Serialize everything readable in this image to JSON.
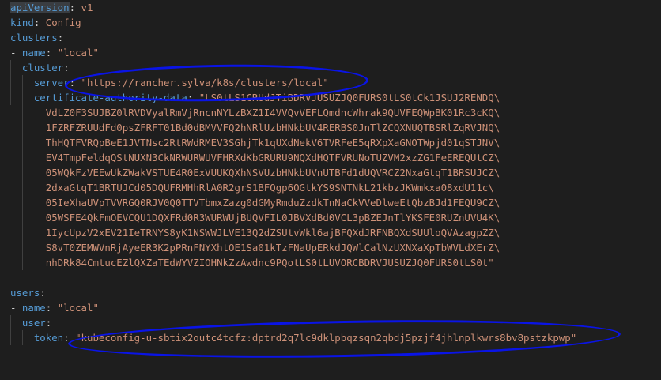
{
  "editor": {
    "lines": [
      {
        "indent": "",
        "tokens": [
          {
            "t": "apiVersion",
            "c": "key"
          },
          {
            "t": ": ",
            "c": "plain"
          },
          {
            "t": "v1",
            "c": "str"
          }
        ]
      },
      {
        "indent": "",
        "tokens": [
          {
            "t": "kind",
            "c": "key"
          },
          {
            "t": ": ",
            "c": "plain"
          },
          {
            "t": "Config",
            "c": "str"
          }
        ]
      },
      {
        "indent": "",
        "tokens": [
          {
            "t": "clusters",
            "c": "key"
          },
          {
            "t": ":",
            "c": "plain"
          }
        ]
      },
      {
        "indent": "",
        "tokens": [
          {
            "t": "- ",
            "c": "plain"
          },
          {
            "t": "name",
            "c": "key"
          },
          {
            "t": ": ",
            "c": "plain"
          },
          {
            "t": "\"local\"",
            "c": "str"
          }
        ]
      },
      {
        "indent": "  ",
        "tokens": [
          {
            "t": "cluster",
            "c": "key"
          },
          {
            "t": ":",
            "c": "plain"
          }
        ]
      },
      {
        "indent": "    ",
        "tokens": [
          {
            "t": "server",
            "c": "key"
          },
          {
            "t": ": ",
            "c": "plain"
          },
          {
            "t": "\"https://rancher.sylva/k8s/clusters/local\"",
            "c": "str"
          }
        ]
      },
      {
        "indent": "    ",
        "tokens": [
          {
            "t": "certificate-authority-data",
            "c": "key"
          },
          {
            "t": ": ",
            "c": "plain"
          },
          {
            "t": "\"LS0tLS1CRUdJTiBDRVJUSUZJQ0FURS0tLS0tCk1JSUJ2RENDQ\\",
            "c": "str"
          }
        ]
      },
      {
        "indent": "      ",
        "tokens": [
          {
            "t": "VdLZ0F3SUJBZ0lRVDVyalRmVjRncnNYLzBXZ1I4VVQvVEFLQmdncWhrak9QUVFEQWpBK01Rc3cKQ\\",
            "c": "str"
          }
        ]
      },
      {
        "indent": "      ",
        "tokens": [
          {
            "t": "1FZRFZRUUdFd0psZFRFT01Bd0dBMVVFQ2hNRlUzbHNkbUV4RERBS0JnTlZCQXNUQTBSRlZqRVJNQ\\",
            "c": "str"
          }
        ]
      },
      {
        "indent": "      ",
        "tokens": [
          {
            "t": "ThHQTFVRQpBeE1JVTNsc2RtRWdRMEV3SGhjTk1qUXdNekV6TVRFeE5qRXpXaGNOTWpjd01qSTJNV\\",
            "c": "str"
          }
        ]
      },
      {
        "indent": "      ",
        "tokens": [
          {
            "t": "EV4TmpFeldqQStNUXN3CkNRWURWUVFHRXdKbGRURU9NQXdHQTFVRUNoTUZVM2xzZG1FeEREQUtCZ\\",
            "c": "str"
          }
        ]
      },
      {
        "indent": "      ",
        "tokens": [
          {
            "t": "05WQkFzVEEwUkZWakVSTUE4R0ExVUUKQXhNSVUzbHNkbUVnUTBFd1dUQVRCZ2NxaGtqT1BRSUJCZ\\",
            "c": "str"
          }
        ]
      },
      {
        "indent": "      ",
        "tokens": [
          {
            "t": "2dxaGtqT1BRTUJCd05DQUFRMHhRlA0R2grS1BFQgp6OGtkYS9SNTNkL21kbzJKWmkxa08xdU11c\\",
            "c": "str"
          }
        ]
      },
      {
        "indent": "      ",
        "tokens": [
          {
            "t": "05IeXhaUVpTVVRGQ0RJV0Q0TTVTbmxZazg0dGMyRmduZzdkTnNaCkVVeDlweEtQbzBJd1FEQU9CZ\\",
            "c": "str"
          }
        ]
      },
      {
        "indent": "      ",
        "tokens": [
          {
            "t": "05WSFE4QkFmOEVCQU1DQXFRd0R3WURWUjBUQVFIL0JBVXdBd0VCL3pBZEJnTlYKSFE0RUZnUVU4K\\",
            "c": "str"
          }
        ]
      },
      {
        "indent": "      ",
        "tokens": [
          {
            "t": "1IycUpzV2xEV21IeTRNYS8yK1NSWWJLVE13Q2dZSUtvWkl6ajBFQXdJRFNBQXdSUUloQVAzagpZZ\\",
            "c": "str"
          }
        ]
      },
      {
        "indent": "      ",
        "tokens": [
          {
            "t": "S8vT0ZEMWVnRjAyeER3K2pPRnFNYXhtOE1Sa01kTzFNaUpERkdJQWlCalNzUXNXaXpTbWVLdXErZ\\",
            "c": "str"
          }
        ]
      },
      {
        "indent": "      ",
        "tokens": [
          {
            "t": "nhDRk84CmtucEZlQXZaTEdWYVZIOHNkZzAwdnc9PQotLS0tLUVORCBDRVJUSUZJQ0FURS0tLS0t\"",
            "c": "str"
          }
        ]
      },
      {
        "indent": "",
        "tokens": []
      },
      {
        "indent": "",
        "tokens": [
          {
            "t": "users",
            "c": "key"
          },
          {
            "t": ":",
            "c": "plain"
          }
        ]
      },
      {
        "indent": "",
        "tokens": [
          {
            "t": "- ",
            "c": "plain"
          },
          {
            "t": "name",
            "c": "key"
          },
          {
            "t": ": ",
            "c": "plain"
          },
          {
            "t": "\"local\"",
            "c": "str"
          }
        ]
      },
      {
        "indent": "  ",
        "tokens": [
          {
            "t": "user",
            "c": "key"
          },
          {
            "t": ":",
            "c": "plain"
          }
        ]
      },
      {
        "indent": "    ",
        "tokens": [
          {
            "t": "token",
            "c": "key"
          },
          {
            "t": ": ",
            "c": "plain"
          },
          {
            "t": "\"kubeconfig-u-sbtix2outc4tcfz:dptrd2q7lc9dklpbqzsqn2qbdj5pzjf4jhlnplkwrs8bv8pstzkpwp\"",
            "c": "str"
          }
        ]
      }
    ]
  },
  "annotations": [
    "server-url-circle",
    "token-circle"
  ],
  "colors": {
    "background": "#1e1e1e",
    "key": "#569cd6",
    "string": "#ce9178",
    "annotation": "#0a14e6"
  }
}
